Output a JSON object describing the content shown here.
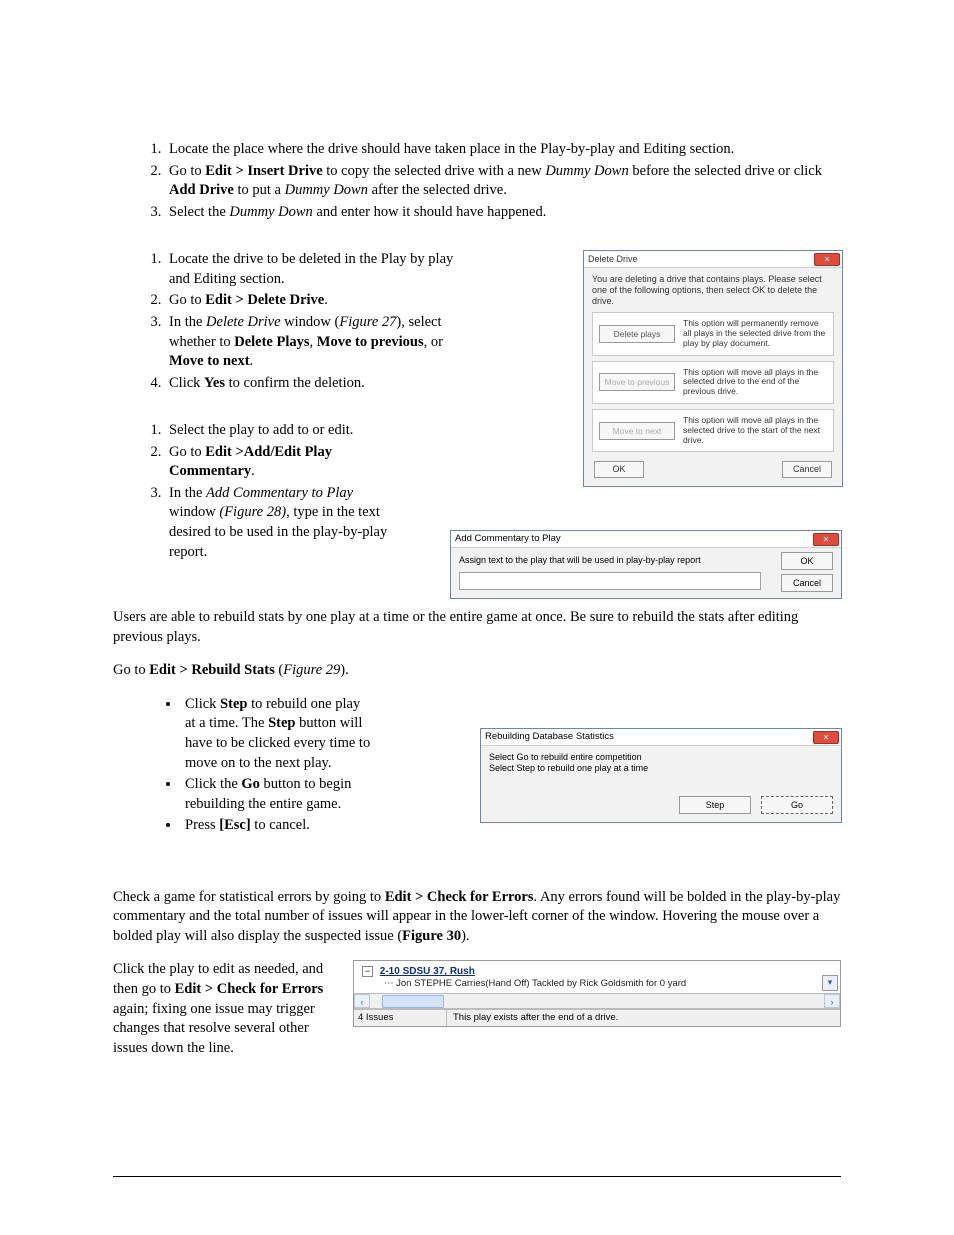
{
  "sec1": {
    "items": [
      {
        "segments": [
          {
            "t": "Locate the place where the drive should have taken place in the Play-by-play and Editing section."
          }
        ]
      },
      {
        "segments": [
          {
            "t": "Go to "
          },
          {
            "t": "Edit > Insert Drive",
            "b": true
          },
          {
            "t": " to copy the selected drive with a new "
          },
          {
            "t": "Dummy Down",
            "i": true
          },
          {
            "t": " before the selected drive or click "
          },
          {
            "t": "Add Drive",
            "b": true
          },
          {
            "t": " to put a "
          },
          {
            "t": "Dummy Down",
            "i": true
          },
          {
            "t": " after the selected drive."
          }
        ]
      },
      {
        "segments": [
          {
            "t": "Select the "
          },
          {
            "t": "Dummy Down",
            "i": true
          },
          {
            "t": " and enter how it should have happened."
          }
        ]
      }
    ]
  },
  "sec2": {
    "items": [
      {
        "segments": [
          {
            "t": "Locate the drive to be deleted in the Play by play and Editing section."
          }
        ]
      },
      {
        "segments": [
          {
            "t": "Go to "
          },
          {
            "t": "Edit > Delete Drive",
            "b": true
          },
          {
            "t": "."
          }
        ]
      },
      {
        "segments": [
          {
            "t": "In the "
          },
          {
            "t": "Delete Drive",
            "i": true
          },
          {
            "t": " window ("
          },
          {
            "t": "Figure 27",
            "i": true
          },
          {
            "t": "), select whether to "
          },
          {
            "t": "Delete Plays",
            "b": true
          },
          {
            "t": ", "
          },
          {
            "t": "Move to previous",
            "b": true
          },
          {
            "t": ", or "
          },
          {
            "t": "Move to next",
            "b": true
          },
          {
            "t": "."
          }
        ]
      },
      {
        "segments": [
          {
            "t": "Click "
          },
          {
            "t": "Yes",
            "b": true
          },
          {
            "t": " to confirm the deletion."
          }
        ]
      }
    ]
  },
  "sec3": {
    "items": [
      {
        "segments": [
          {
            "t": "Select the play to add to or edit."
          }
        ]
      },
      {
        "segments": [
          {
            "t": "Go to "
          },
          {
            "t": "Edit >Add/Edit Play Commentary",
            "b": true
          },
          {
            "t": "."
          }
        ]
      },
      {
        "segments": [
          {
            "t": "In the "
          },
          {
            "t": "Add Commentary to Play",
            "i": true
          },
          {
            "t": " window "
          },
          {
            "t": "(Figure 28)",
            "i": true
          },
          {
            "t": ", type in the text desired to be used in the play-by-play report."
          }
        ]
      }
    ]
  },
  "rebuild": {
    "para": "Users are able to rebuild stats by one play at a time or the entire game at once. Be sure to rebuild the stats after editing previous plays.",
    "lead_segments": [
      {
        "t": "Go to "
      },
      {
        "t": "Edit > Rebuild Stats",
        "b": true
      },
      {
        "t": " ("
      },
      {
        "t": "Figure 29",
        "i": true
      },
      {
        "t": ")."
      }
    ],
    "bullets": [
      {
        "segments": [
          {
            "t": "Click "
          },
          {
            "t": "Step",
            "b": true
          },
          {
            "t": " to rebuild one play at a time. The "
          },
          {
            "t": "Step",
            "b": true
          },
          {
            "t": " button will have to be clicked every time to move on to the next play."
          }
        ]
      },
      {
        "segments": [
          {
            "t": "Click the "
          },
          {
            "t": "Go",
            "b": true
          },
          {
            "t": " button to begin rebuilding the entire game."
          }
        ]
      },
      {
        "segments": [
          {
            "t": "Press "
          },
          {
            "t": "[Esc]",
            "b": true
          },
          {
            "t": " to cancel."
          }
        ]
      }
    ]
  },
  "errors": {
    "para_segments": [
      {
        "t": "Check a game for statistical errors by going to "
      },
      {
        "t": "Edit > Check for Errors",
        "b": true
      },
      {
        "t": ". Any errors found will be bolded in the play-by-play commentary and the total number of issues will appear in the lower-left corner of the window. Hovering the mouse over a bolded play will also display the suspected issue ("
      },
      {
        "t": "Figure 30",
        "b": true
      },
      {
        "t": ")."
      }
    ],
    "para2_segments": [
      {
        "t": "Click the play to edit as needed, and then go to "
      },
      {
        "t": "Edit > Check for Errors",
        "b": true
      },
      {
        "t": " again; fixing one issue may trigger changes that resolve several other issues down the line."
      }
    ]
  },
  "dlg_delete": {
    "title": "Delete Drive",
    "intro": "You are deleting a drive that contains plays. Please select one of the following options, then select OK to delete the drive.",
    "opt1_btn": "Delete plays",
    "opt1_desc": "This option will permanently remove all plays in the selected drive from the play by play document.",
    "opt2_btn": "Move to previous",
    "opt2_desc": "This option will move all plays in the selected drive to the end of the previous drive.",
    "opt3_btn": "Move to next",
    "opt3_desc": "This option will move all plays in the selected drive to the start of the next drive.",
    "ok": "OK",
    "cancel": "Cancel"
  },
  "dlg_comment": {
    "title": "Add Commentary to Play",
    "assign": "Assign text to the play that will be used in play-by-play report",
    "ok": "OK",
    "cancel": "Cancel"
  },
  "dlg_rebuild": {
    "title": "Rebuilding Database Statistics",
    "msg1": "Select Go to rebuild entire competition",
    "msg2": "Select Step to rebuild one play at a time",
    "step": "Step",
    "go": "Go"
  },
  "fig30": {
    "tree_title": "2-10  SDSU 37,  Rush",
    "sub": "Jon STEPHE     Carries(Hand Off) Tackled by Rick Goldsmith for 0 yard",
    "status_count": "4 Issues",
    "status_msg": "This play exists after the end of a drive."
  }
}
